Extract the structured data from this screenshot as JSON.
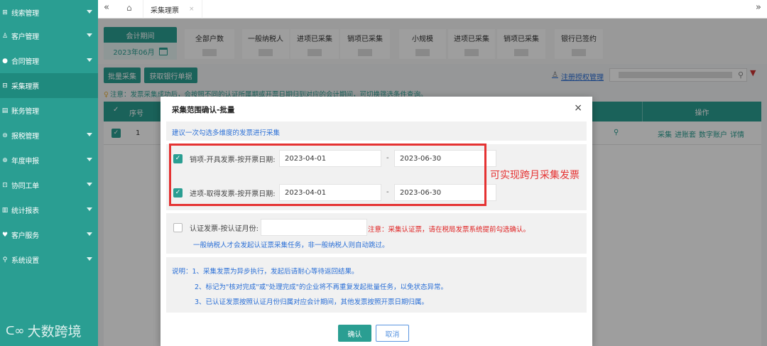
{
  "sidebar": {
    "items": [
      {
        "icon": "⊞",
        "label": "线索管理",
        "active": false
      },
      {
        "icon": "♙",
        "label": "客户管理",
        "active": false
      },
      {
        "icon": "●",
        "label": "合同管理",
        "active": false
      },
      {
        "icon": "⊟",
        "label": "采集理票",
        "active": true
      },
      {
        "icon": "▤",
        "label": "账务管理",
        "active": false
      },
      {
        "icon": "⊜",
        "label": "报税管理",
        "active": false
      },
      {
        "icon": "⊕",
        "label": "年度申报",
        "active": false
      },
      {
        "icon": "⊡",
        "label": "协同工单",
        "active": false
      },
      {
        "icon": "▥",
        "label": "统计报表",
        "active": false
      },
      {
        "icon": "♥",
        "label": "客户服务",
        "active": false
      },
      {
        "icon": "⚲",
        "label": "系统设置",
        "active": false
      }
    ],
    "watermark": "大数跨境"
  },
  "tabbar": {
    "prev_icon": "«",
    "home_icon": "⌂",
    "tab_label": "采集理票",
    "tab_close": "×",
    "next_icon": "»"
  },
  "stats": {
    "period_title": "会计期间",
    "period_value": "2023年06月",
    "items": [
      {
        "label": "全部户数"
      },
      {
        "label": "一般纳税人"
      },
      {
        "label": "进项已采集"
      },
      {
        "label": "销项已采集"
      },
      {
        "label": "小规模"
      },
      {
        "label": "进项已采集"
      },
      {
        "label": "销项已采集"
      },
      {
        "label": "银行已签约"
      }
    ]
  },
  "toolbar": {
    "batch_collect": "批量采集",
    "get_bank": "获取银行单据",
    "register_link": "注册授权管理",
    "notice": "注意：发票采集成功后，会按照不同的认证所属期或开票日期归到对应的会计期间，可切换筛选条件查询。"
  },
  "table": {
    "header_seq": "序号",
    "header_op": "操作",
    "row": {
      "seq": "1",
      "ops": [
        "采集",
        "进账套",
        "数字账户",
        "详情"
      ]
    }
  },
  "modal": {
    "title": "采集范围确认-批量",
    "hint": "建议一次勾选多维度的发票进行采集",
    "sales": {
      "label": "销项-开具发票-按开票日期:",
      "checked": true,
      "start": "2023-04-01",
      "end": "2023-06-30"
    },
    "purchase": {
      "label": "进项-取得发票-按开票日期:",
      "checked": true,
      "start": "2023-04-01",
      "end": "2023-06-30"
    },
    "dash": "-",
    "cert": {
      "label": "认证发票-按认证月份:",
      "checked": false,
      "value": "",
      "warning": "注意：采集认证票，请在税局发票系统提前勾选确认。",
      "note": "一般纳税人才会发起认证票采集任务，非一般纳税人则自动跳过。"
    },
    "desc": [
      "说明：1、采集发票为异步执行，发起后请耐心等待返回结果。",
      "2、标记为\"核对完成\"或\"处理完成\"的企业将不再重复发起批量任务，以免状态异常。",
      "3、已认证发票按照认证月份归属对应会计期间，其他发票按照开票日期归属。"
    ],
    "confirm": "确认",
    "cancel": "取消"
  },
  "annotation": "可实现跨月采集发票",
  "colors": {
    "primary": "#2a9e92",
    "link": "#2a6fd6",
    "warning": "#e02020",
    "annotation": "#e53232"
  }
}
